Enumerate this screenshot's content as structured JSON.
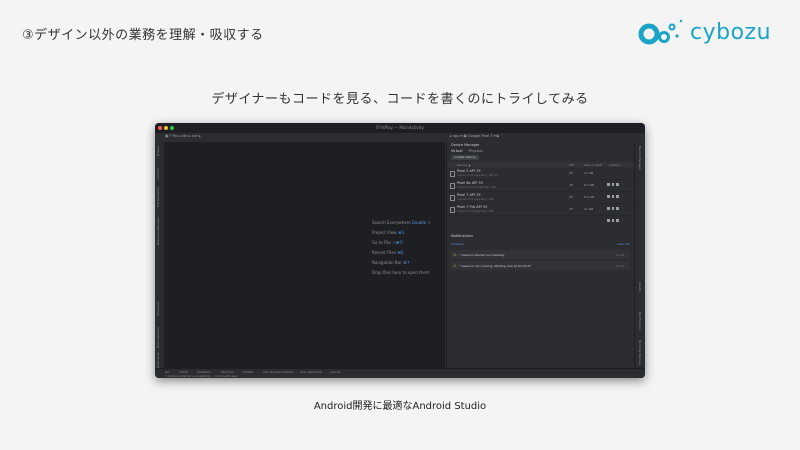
{
  "slide": {
    "title": "③デザイン以外の業務を理解・吸収する",
    "heading": "デザイナーもコードを見る、コードを書くのにトライしてみる",
    "caption": "Android開発に最適なAndroid Studio",
    "logo_text": "cybozu",
    "brand_color": "#1aa4c8"
  },
  "ide": {
    "window_title": "FFmPlay — MainActivity",
    "toolbar": {
      "project": "▣ F ffv ▸ odls ▸ odr ▸",
      "run_config": "▸ app ▾   ▣ Google Pixel 5 ▾   ▶"
    },
    "left_tools": [
      "Project",
      "Commit",
      "Pull Requests",
      "Resource Manager",
      "Structure",
      "Build Variants",
      "Bookmarks"
    ],
    "editor_hints": [
      {
        "label": "Search Everywhere",
        "key": "Double ⇧"
      },
      {
        "label": "Project View",
        "key": "⌘1"
      },
      {
        "label": "Go to File",
        "key": "⇧⌘O"
      },
      {
        "label": "Recent Files",
        "key": "⌘E"
      },
      {
        "label": "Navigation Bar",
        "key": "⌘↑"
      },
      {
        "label": "Drop files here to open them",
        "key": ""
      }
    ],
    "device_manager": {
      "title": "Device Manager",
      "tabs": [
        "Virtual",
        "Physical"
      ],
      "create_button": "Create Device",
      "columns": [
        "Device ▲",
        "API",
        "Size on Disk",
        "Actions"
      ],
      "devices": [
        {
          "name": "Pixel 5 API 33",
          "sub": "Android 13 Google Play | x86_64",
          "api": "33",
          "size": "12 GB"
        },
        {
          "name": "Pixel 6a API 30",
          "sub": "Android 11.0 Google Play | x86",
          "api": "30",
          "size": "8.7 GB"
        },
        {
          "name": "Pixel 7 API 33",
          "sub": "Android 13 Google Play | x86",
          "api": "33",
          "size": "8.6 GB"
        },
        {
          "name": "Pixel 7 Pro API 33",
          "sub": "Android 13 Google Play | x86",
          "api": "33",
          "size": "11 GB"
        }
      ]
    },
    "notifications": {
      "title": "Notifications",
      "subtitle": "Timeline",
      "clear": "Clear all",
      "items": [
        {
          "text": "* daemon started successfully",
          "time": "10:41"
        },
        {
          "text": "* daemon not running; starting now at tcp:5037",
          "time": "10:41"
        }
      ]
    },
    "right_tools": [
      "Device Manager",
      "Notifications",
      "Gradle",
      "Running Devices"
    ],
    "bottom_tools": [
      "Git",
      "TODO",
      "Problems",
      "Terminal",
      "Profiler",
      "App Quality Insights",
      "App Inspection",
      "Logcat"
    ],
    "status_text": "* daemon started successfully ... (moments ago)"
  }
}
